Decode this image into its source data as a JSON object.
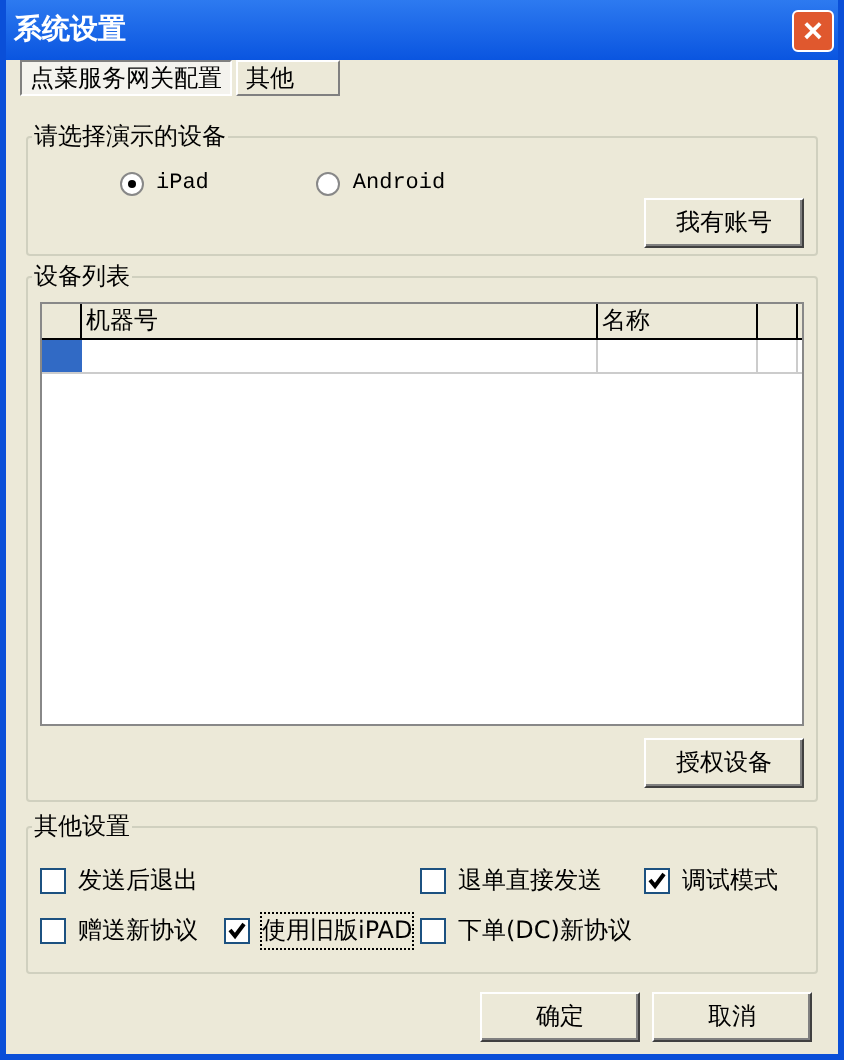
{
  "window": {
    "title": "系统设置",
    "close": "×"
  },
  "tabs": [
    {
      "label": "点菜服务网关配置",
      "selected": true
    },
    {
      "label": "其他",
      "selected": false
    }
  ],
  "device_group": {
    "title": "请选择演示的设备",
    "options": [
      {
        "label": "iPad",
        "selected": true
      },
      {
        "label": "Android",
        "selected": false
      }
    ],
    "button": "我有账号"
  },
  "device_list": {
    "title": "设备列表",
    "columns": [
      "机器号",
      "名称"
    ],
    "rows": [
      {
        "selected": true,
        "cells": [
          "",
          ""
        ]
      }
    ],
    "button": "授权设备"
  },
  "other_settings": {
    "title": "其他设置",
    "rows": [
      [
        {
          "label": "发送后退出",
          "checked": false
        },
        "",
        {
          "label": "退单直接发送",
          "checked": false
        },
        {
          "label": "调试模式",
          "checked": true
        }
      ],
      [
        {
          "label": "赠送新协议",
          "checked": false
        },
        {
          "label": "使用旧版iPAD",
          "checked": true,
          "focused": true
        },
        {
          "label": "下单(DC)新协议",
          "checked": false
        }
      ]
    ]
  },
  "buttons": [
    "确定",
    "取消"
  ]
}
